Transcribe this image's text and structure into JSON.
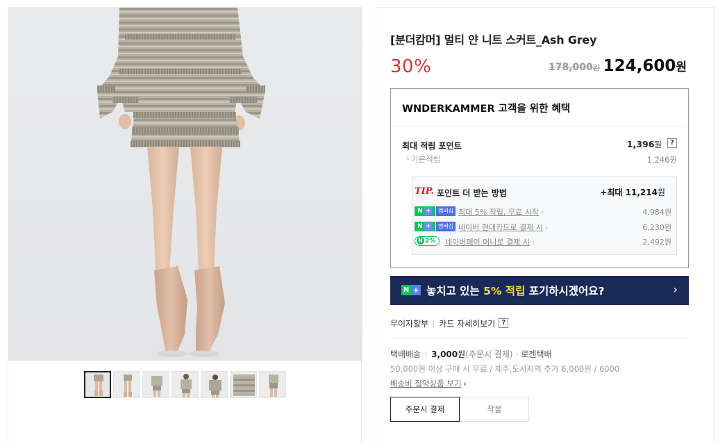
{
  "product": {
    "title": "[분더캄머] 멀티 얀 니트 스커트_Ash Grey",
    "discount_rate": "30%",
    "original_price": "178,000",
    "original_price_unit": "원",
    "sale_price": "124,600",
    "sale_price_unit": "원"
  },
  "gallery": {
    "thumbnail_count": 7,
    "active_index": 0
  },
  "benefits": {
    "title": "WNDERKAMMER 고객을 위한 혜택",
    "max_points_label": "최대 적립 포인트",
    "max_points_value": "1,396",
    "max_points_unit": "원",
    "help_label": "?",
    "base_label": "기본적립",
    "base_branch": "└",
    "base_value": "1,246원",
    "tip": {
      "mark": "TIP.",
      "title": "포인트 더 받는 방법",
      "max_label": "+최대 11,214",
      "max_unit": "원",
      "rows": [
        {
          "badge_n": "N",
          "badge_plus": "+",
          "badge_mem": "멤버십",
          "link": "최대 5% 적립, 무료 시작",
          "arrow": "›",
          "value": "4,984원"
        },
        {
          "badge_n": "N",
          "badge_plus": "+",
          "badge_mem": "멤버십",
          "link": "네이버 현대카드로 결제 시",
          "arrow": "›",
          "value": "6,230원"
        },
        {
          "badge_icon": "N",
          "badge_rate": "2%",
          "link": "네이버페이 머니로 결제 시",
          "arrow": "›",
          "value": "2,492원"
        }
      ]
    }
  },
  "promo": {
    "badge_n": "N",
    "badge_plus": "+",
    "text_before": "놓치고 있는 ",
    "text_highlight": "5% 적립",
    "text_after": " 포기하시겠어요?",
    "arrow": "›",
    "accent_color": "#f5d94c",
    "background_color": "#1a2a56"
  },
  "installment": {
    "label": "무이자할부",
    "card_link": "카드 자세히보기",
    "help_label": "?"
  },
  "shipping": {
    "method": "택배배송",
    "fee": "3,000",
    "fee_unit": "원",
    "fee_condition": "(주문시 결제)",
    "dot": "·",
    "carrier": "로젠택배",
    "free_note": "50,000원 이상 구매 시 무료 / 제주,도서지역 추가 6,000원 / 6000",
    "bundle_link": "배송비 절약상품 보기",
    "bundle_arrow": "›"
  },
  "payment_options": [
    {
      "label": "주문시 결제",
      "active": true
    },
    {
      "label": "착불",
      "active": false
    }
  ],
  "colors": {
    "discount": "#c8363e",
    "naver_green": "#03c75a",
    "tip_red": "#d4202b"
  }
}
